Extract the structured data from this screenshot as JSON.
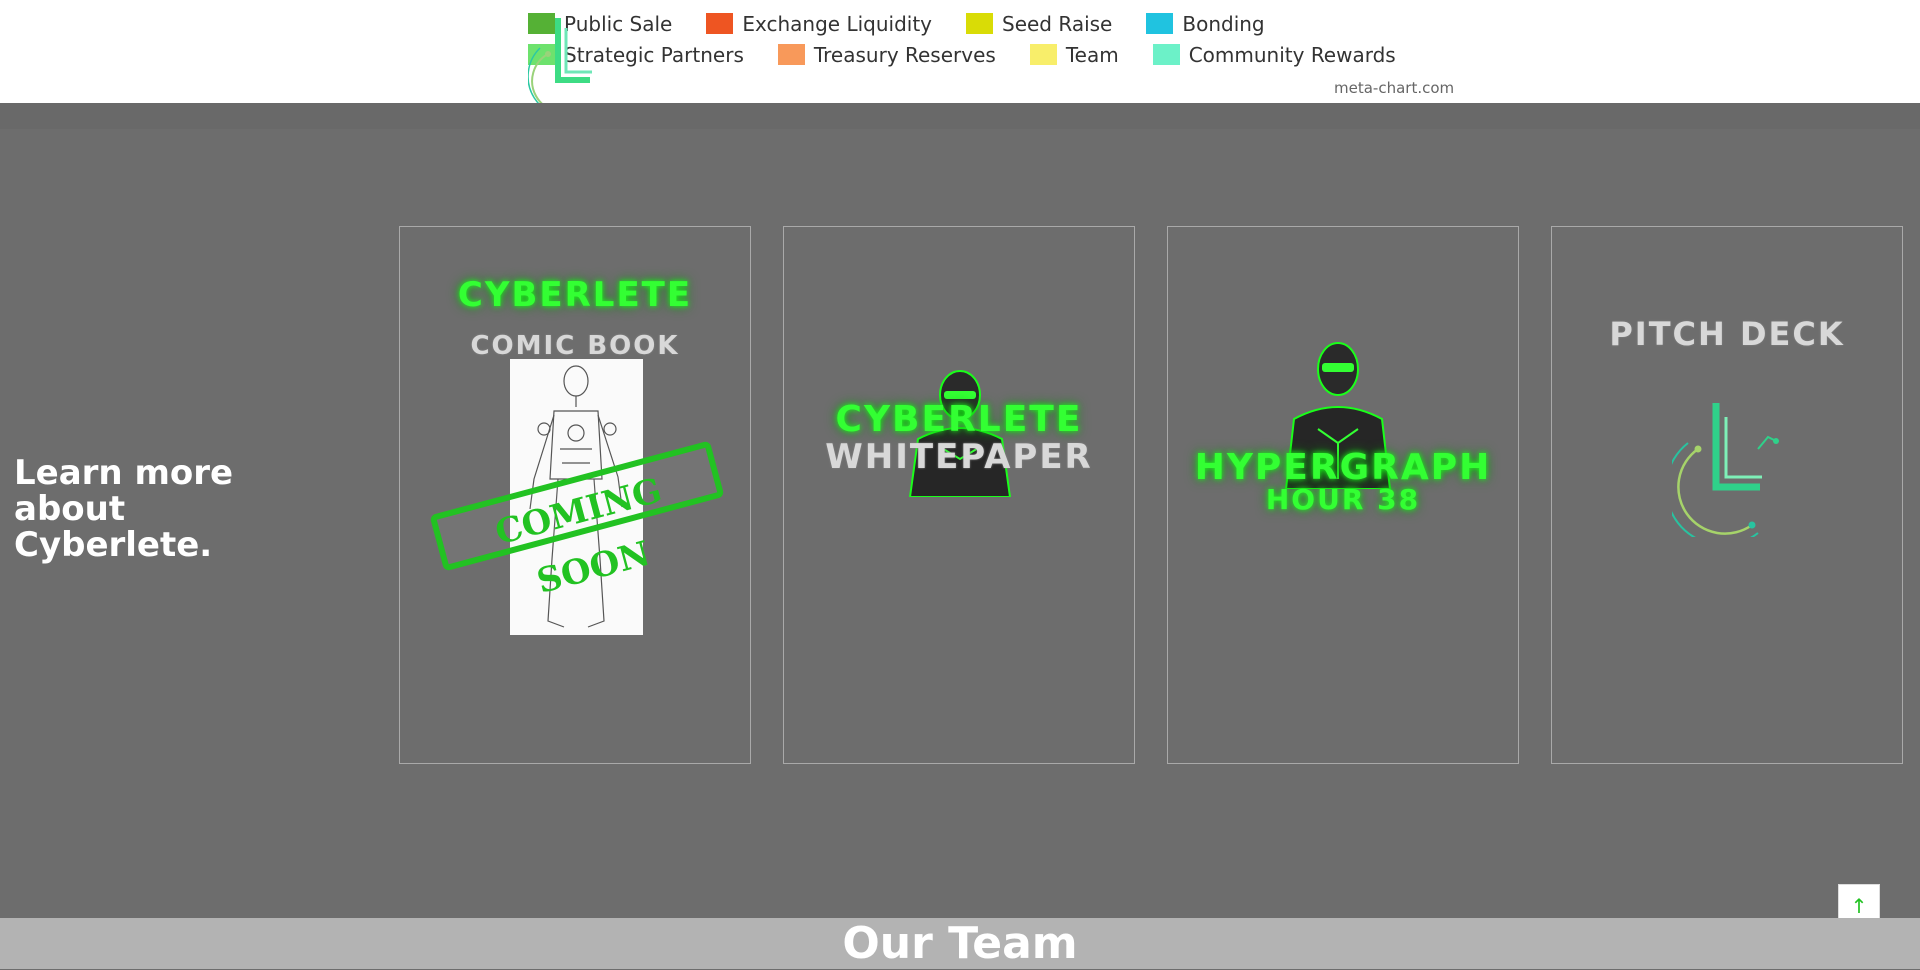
{
  "legend": {
    "row1": [
      {
        "label": "Public Sale",
        "color": "#55b135"
      },
      {
        "label": "Exchange Liquidity",
        "color": "#ee5522"
      },
      {
        "label": "Seed Raise",
        "color": "#d9dc06"
      },
      {
        "label": "Bonding",
        "color": "#20c3e0"
      }
    ],
    "row2": [
      {
        "label": "Strategic Partners",
        "color": "#6de26d"
      },
      {
        "label": "Treasury Reserves",
        "color": "#f8995a"
      },
      {
        "label": "Team",
        "color": "#f8ee6a"
      },
      {
        "label": "Community Rewards",
        "color": "#6cf1c8"
      }
    ],
    "credit": "meta-chart.com"
  },
  "learn": {
    "heading": "Learn more about Cyberlete."
  },
  "cards": {
    "comic": {
      "title": "CYBERLETE",
      "subtitle": "COMIC BOOK",
      "stamp": "COMING SOON"
    },
    "whitepaper": {
      "title": "CYBERLETE",
      "subtitle": "WHITEPAPER"
    },
    "hypergraph": {
      "title": "HYPERGRAPH",
      "subtitle": "HOUR 38"
    },
    "pitch": {
      "title": "PITCH DECK"
    }
  },
  "team": {
    "heading": "Our Team"
  },
  "icons": {
    "back_to_top": "arrow-up-icon"
  },
  "colors": {
    "neon_green": "#33ff33",
    "band_gray": "#6d6d6d",
    "team_band": "#b3b3b3"
  }
}
